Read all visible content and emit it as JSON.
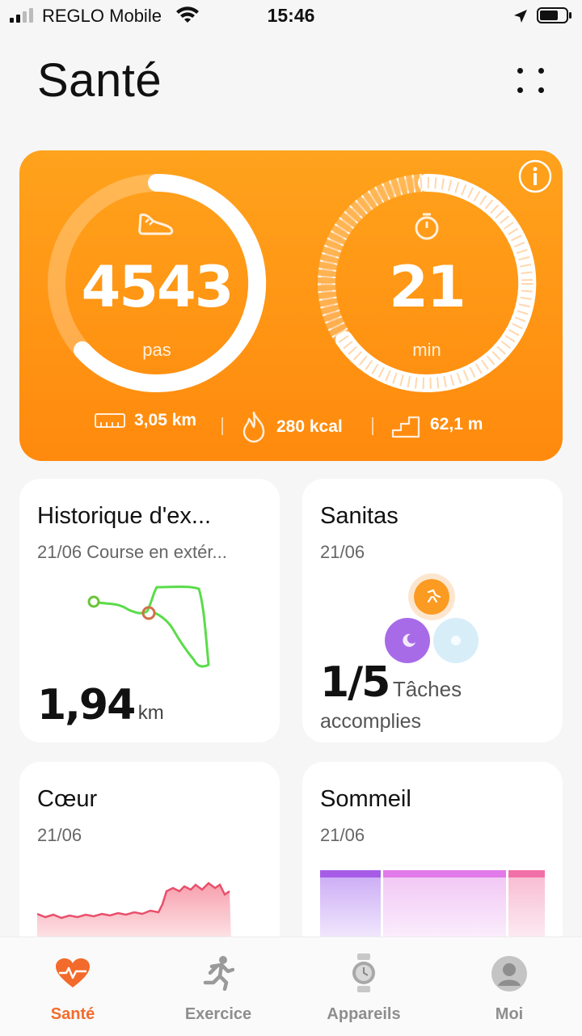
{
  "status_bar": {
    "carrier": "REGLO Mobile",
    "time": "15:46"
  },
  "header": {
    "title": "Santé"
  },
  "activity": {
    "steps_value": "4543",
    "steps_unit": "pas",
    "minutes_value": "21",
    "minutes_unit": "min",
    "distance": "3,05 km",
    "calories": "280 kcal",
    "elevation": "62,1 m",
    "accent_color": "#ff8f10"
  },
  "cards": {
    "exercise_history": {
      "title": "Historique d'ex...",
      "subtitle": "21/06 Course en extér...",
      "value": "1,94",
      "unit": "km"
    },
    "sanitas": {
      "title": "Sanitas",
      "subtitle": "21/06",
      "value": "1/5",
      "label_line1": "Tâches",
      "label_line2": "accomplies"
    },
    "heart": {
      "title": "Cœur",
      "subtitle": "21/06"
    },
    "sleep": {
      "title": "Sommeil",
      "subtitle": "21/06"
    }
  },
  "nav": {
    "items": [
      {
        "label": "Santé",
        "icon": "heart-pulse-icon",
        "active": true
      },
      {
        "label": "Exercice",
        "icon": "runner-icon",
        "active": false
      },
      {
        "label": "Appareils",
        "icon": "watch-icon",
        "active": false
      },
      {
        "label": "Moi",
        "icon": "user-icon",
        "active": false
      }
    ],
    "active_color": "#f26b2c",
    "inactive_color": "#8e8e8e"
  }
}
